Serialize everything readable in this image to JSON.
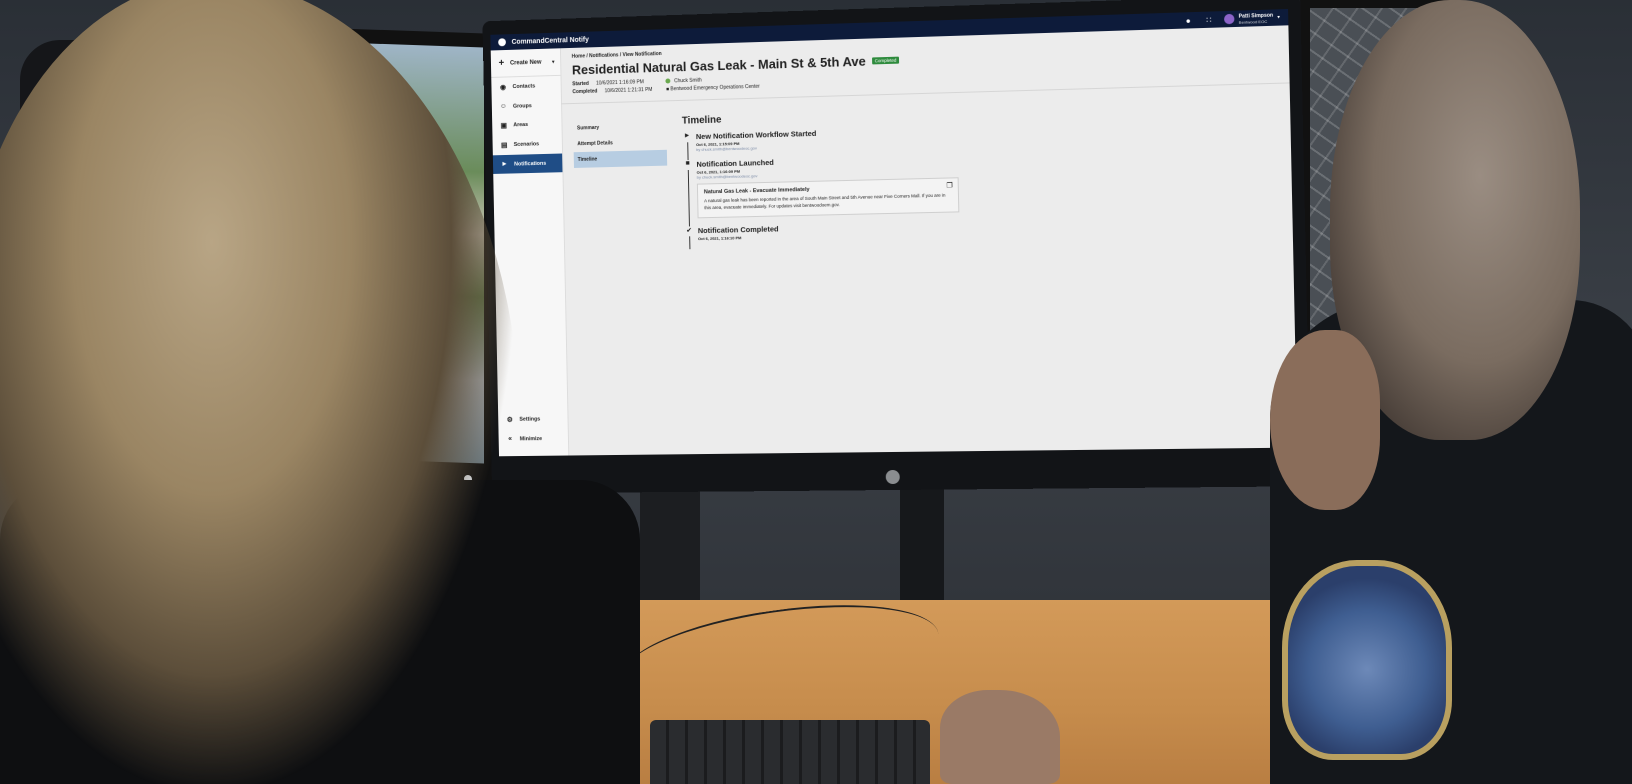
{
  "app": {
    "title": "CommandCentral Notify",
    "user_name": "Patti Simpson",
    "user_org": "Bentwood EOC"
  },
  "sidebar": {
    "create_new": "Create New",
    "items": [
      {
        "label": "Contacts"
      },
      {
        "label": "Groups"
      },
      {
        "label": "Areas"
      },
      {
        "label": "Scenarios"
      },
      {
        "label": "Notifications"
      }
    ],
    "settings": "Settings",
    "minimize": "Minimize"
  },
  "page": {
    "breadcrumb": "Home / Notifications / View Notification",
    "title": "Residential Natural Gas Leak - Main St & 5th Ave",
    "status": "Completed",
    "started_label": "Started",
    "started_value": "10/6/2021 1:16:09 PM",
    "completed_label": "Completed",
    "completed_value": "10/6/2021 1:21:31 PM",
    "owner": "Chuck Smith",
    "organization": "Bentwood Emergency Operations Center"
  },
  "subnav": {
    "items": [
      {
        "label": "Summary"
      },
      {
        "label": "Attempt Details"
      },
      {
        "label": "Timeline"
      }
    ]
  },
  "timeline": {
    "title": "Timeline",
    "events": [
      {
        "title": "New Notification Workflow Started",
        "time": "Oct 6, 2021, 1:15:09 PM",
        "by": "by chuck.smith@bentwoodeoc.gov"
      },
      {
        "title": "Notification Launched",
        "time": "Oct 6, 2021, 1:16:09 PM",
        "by": "by chuck.smith@bentwoodeoc.gov",
        "message_title": "Natural Gas Leak - Evacuate Immediately",
        "message_body": "A natural gas leak has been reported in the area of South Main Street and 5th Avenue near Five Corners Mall. If you are in this area, evacuate immediately. For updates visit bentwoodoem.gov."
      },
      {
        "title": "Notification Completed",
        "time": "Oct 6, 2021, 1:16:10 PM"
      }
    ]
  },
  "colors": {
    "topbar": "#0d1b3a",
    "nav_active": "#1f4d86",
    "badge": "#2e8b3d"
  }
}
